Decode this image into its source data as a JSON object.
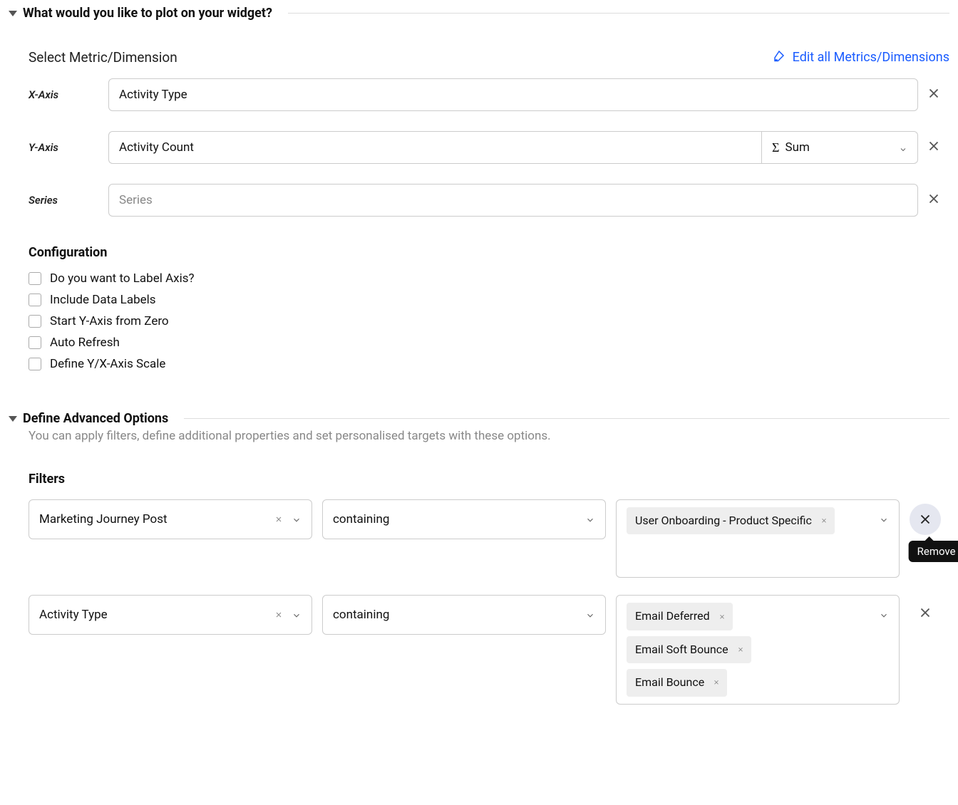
{
  "plot_section": {
    "title": "What would you like to plot on your widget?",
    "metric_header": "Select Metric/Dimension",
    "edit_link": "Edit all Metrics/Dimensions",
    "xaxis_label": "X-Axis",
    "xaxis_value": "Activity Type",
    "yaxis_label": "Y-Axis",
    "yaxis_value": "Activity Count",
    "yaxis_agg": "Sum",
    "series_label": "Series",
    "series_placeholder": "Series"
  },
  "config": {
    "title": "Configuration",
    "opts": [
      "Do you want to Label Axis?",
      "Include Data Labels",
      "Start Y-Axis from Zero",
      "Auto Refresh",
      "Define Y/X-Axis Scale"
    ]
  },
  "advanced": {
    "title": "Define Advanced Options",
    "desc": "You can apply filters, define additional properties and set personalised targets with these options."
  },
  "filters": {
    "title": "Filters",
    "rows": [
      {
        "field": "Marketing Journey Post",
        "op": "containing",
        "values": [
          "User Onboarding - Product Specific"
        ],
        "remove_tooltip": "Remove",
        "highlighted": true,
        "tall": true
      },
      {
        "field": "Activity Type",
        "op": "containing",
        "values": [
          "Email Deferred",
          "Email Soft Bounce",
          "Email Bounce"
        ],
        "highlighted": false,
        "tall": false
      }
    ]
  }
}
